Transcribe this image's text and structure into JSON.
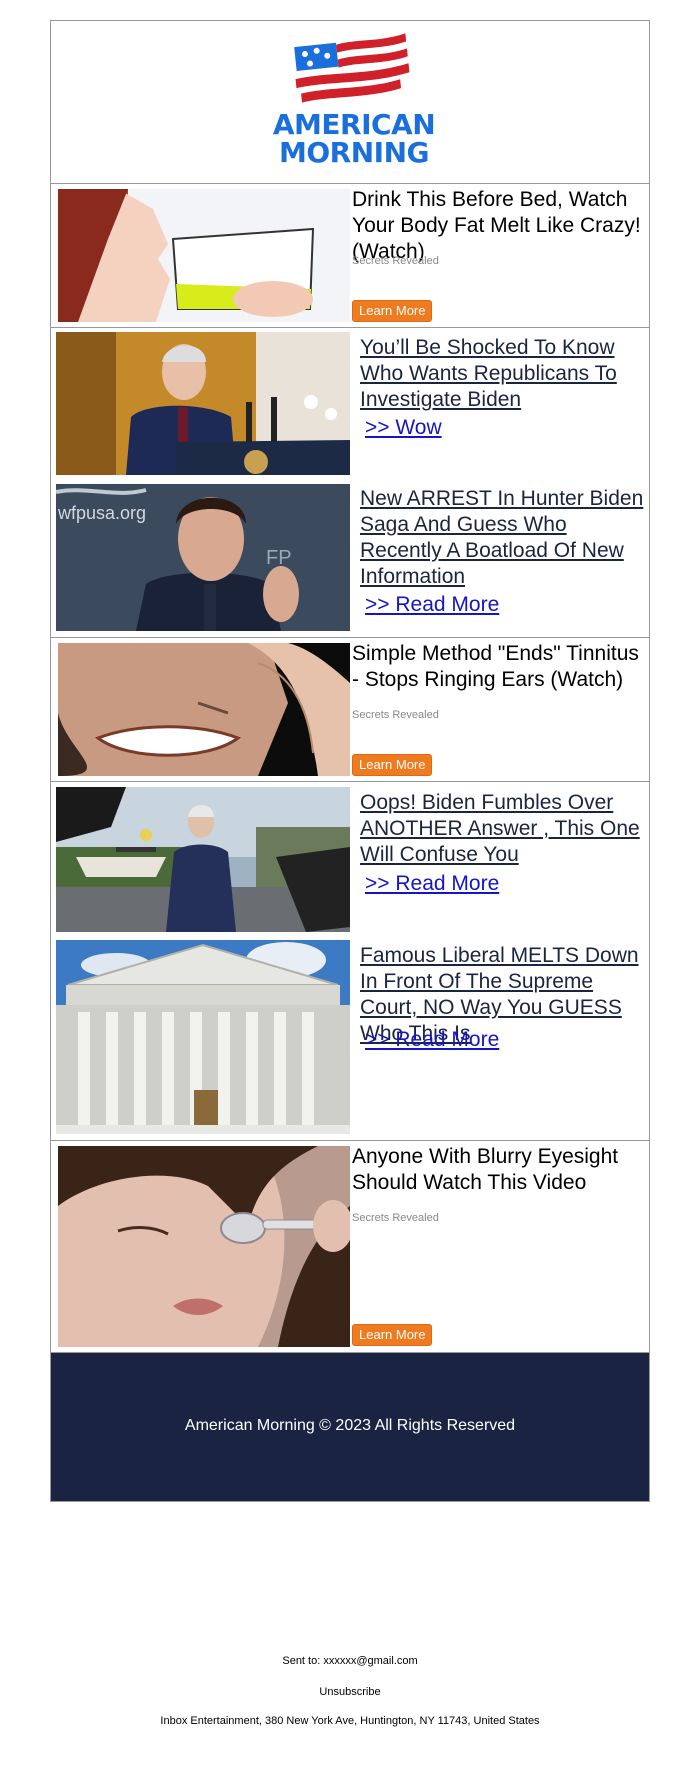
{
  "brand": {
    "name_line1": "AMERICAN",
    "name_line2": "MORNING",
    "colors": {
      "blue": "#1a6fdd",
      "red": "#d0202a",
      "navy": "#1a2442",
      "orange": "#ef7b20"
    }
  },
  "ads": [
    {
      "title": "Drink This Before Bed, Watch Your Body Fat Melt Like Crazy! (Watch)",
      "source": "Secrets Revealed",
      "button": "Learn More"
    },
    {
      "title": "Simple Method \"Ends\" Tinnitus - Stops Ringing Ears (Watch)",
      "source": "Secrets Revealed",
      "button": "Learn More"
    },
    {
      "title": "Anyone With Blurry Eyesight Should Watch This Video",
      "source": "Secrets Revealed",
      "button": "Learn More"
    }
  ],
  "articles": [
    {
      "title": "You’ll Be Shocked To Know Who Wants Republicans To Investigate Biden",
      "link": ">> Wow"
    },
    {
      "title": "New ARREST In Hunter Biden Saga And Guess Who Recently A Boatload Of New Information",
      "link": ">> Read More"
    },
    {
      "title": "Oops! Biden Fumbles Over ANOTHER Answer , This One Will Confuse You",
      "link": ">> Read More"
    },
    {
      "title": "Famous Liberal MELTS Down In Front Of The Supreme Court, NO Way You GUESS Who This Is",
      "link": ">> Read More"
    }
  ],
  "footer": {
    "copyright": "American Morning © 2023 All Rights Reserved",
    "sent_to": "Sent to: xxxxxx@gmail.com",
    "unsubscribe": "Unsubscribe",
    "address": "Inbox Entertainment, 380 New York Ave, Huntington, NY 11743, United States"
  }
}
